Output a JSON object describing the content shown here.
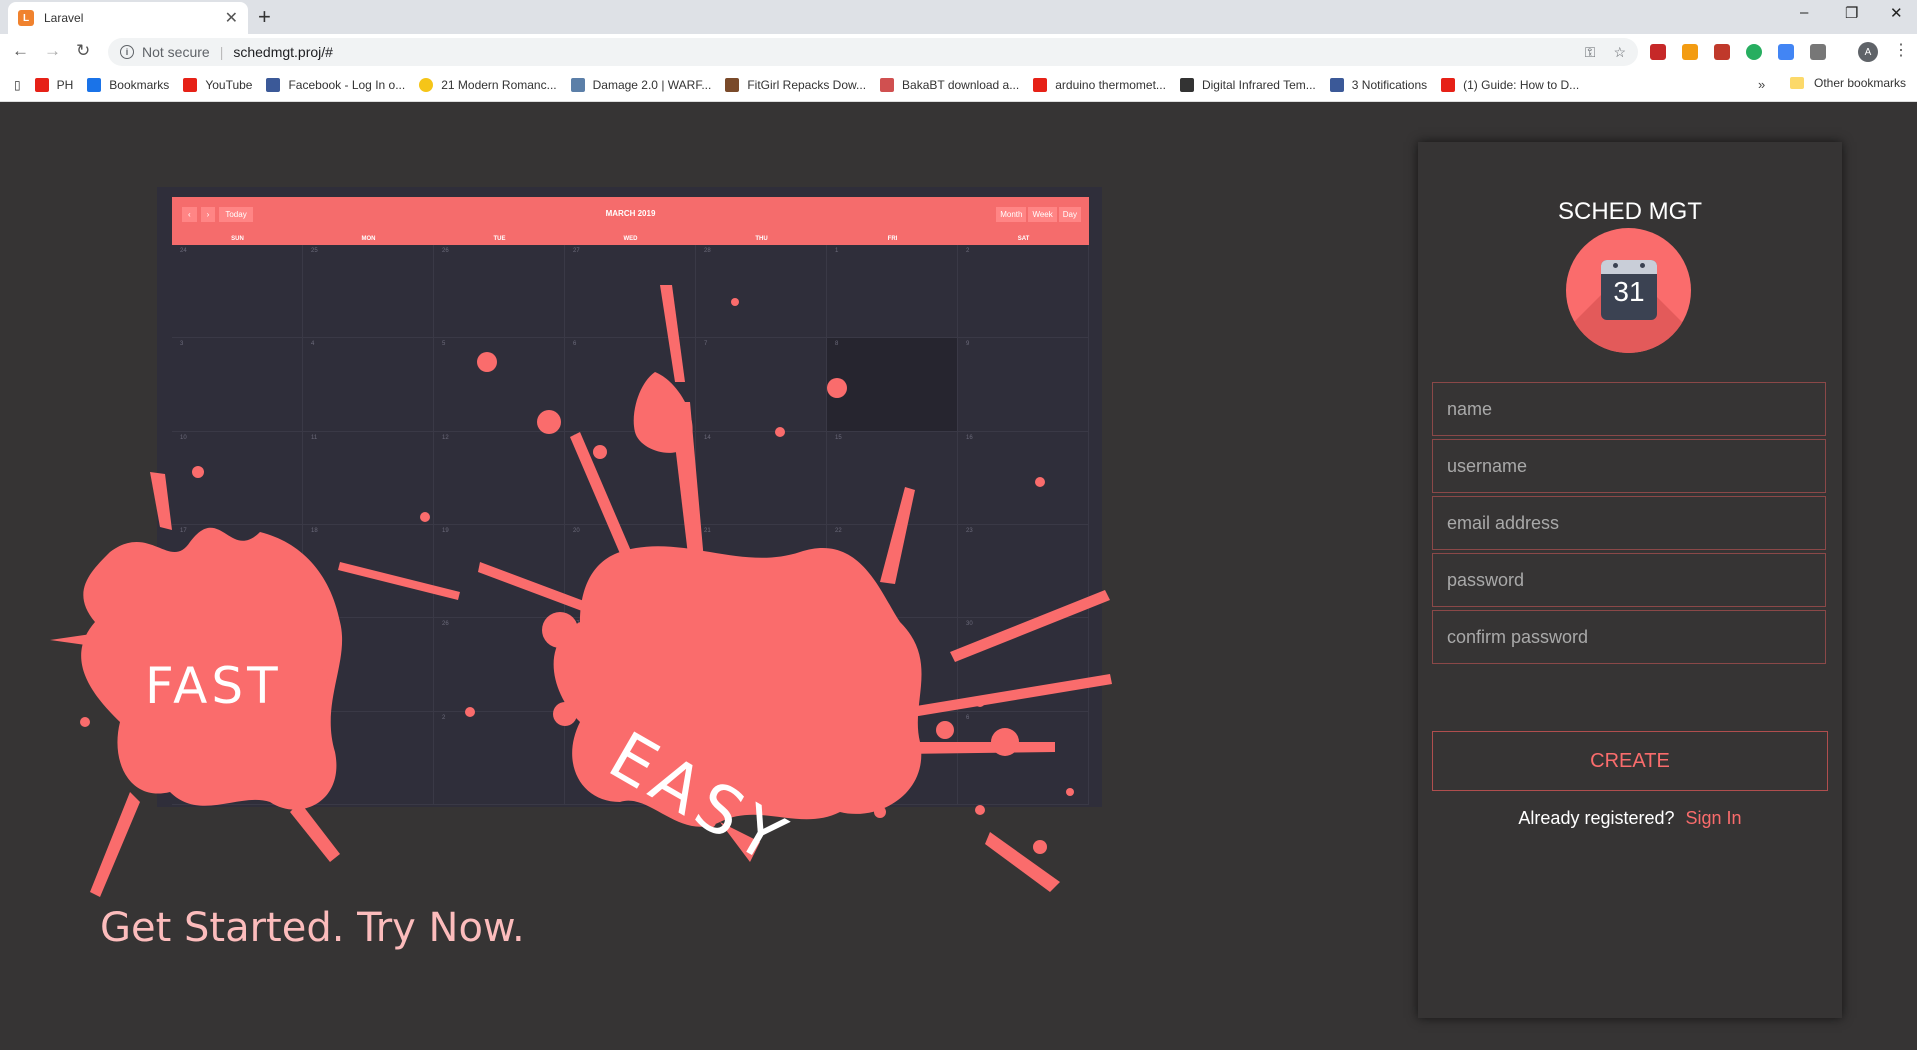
{
  "browser": {
    "tab_title": "Laravel",
    "tab_favicon": "laravel-icon",
    "new_tab_symbol": "+",
    "security_text": "Not secure",
    "url": "schedmgt.proj/#",
    "window_controls": {
      "minimize": "–",
      "restore": "❐",
      "close": "✕"
    },
    "avatar_letter": "A",
    "bookmarks": [
      {
        "label": "PH",
        "icon": "youtube-icon",
        "color": "#e62117"
      },
      {
        "label": "Bookmarks",
        "icon": "star-icon",
        "color": "#1a73e8"
      },
      {
        "label": "YouTube",
        "icon": "youtube-icon",
        "color": "#e62117"
      },
      {
        "label": "Facebook - Log In o...",
        "icon": "facebook-icon",
        "color": "#3b5998"
      },
      {
        "label": "21 Modern Romanc...",
        "icon": "badge-icon",
        "color": "#f5c518"
      },
      {
        "label": "Damage 2.0 | WARF...",
        "icon": "site-icon",
        "color": "#5b7fa8"
      },
      {
        "label": "FitGirl Repacks Dow...",
        "icon": "site-icon",
        "color": "#7a4a2a"
      },
      {
        "label": "BakaBT download a...",
        "icon": "site-icon",
        "color": "#d05050"
      },
      {
        "label": "arduino thermomet...",
        "icon": "youtube-icon",
        "color": "#e62117"
      },
      {
        "label": "Digital Infrared Tem...",
        "icon": "site-icon",
        "color": "#333333"
      },
      {
        "label": "3 Notifications",
        "icon": "facebook-icon",
        "color": "#3b5998"
      },
      {
        "label": "(1) Guide: How to D...",
        "icon": "youtube-icon",
        "color": "#e62117"
      }
    ],
    "bookmarks_more": "»",
    "other_bookmarks": "Other bookmarks"
  },
  "calendar": {
    "title": "MARCH 2019",
    "today_label": "Today",
    "views": [
      "Month",
      "Week",
      "Day"
    ],
    "weekdays": [
      "SUN",
      "MON",
      "TUE",
      "WED",
      "THU",
      "FRI",
      "SAT"
    ],
    "days": [
      "24",
      "25",
      "26",
      "27",
      "28",
      "1",
      "2",
      "3",
      "4",
      "5",
      "6",
      "7",
      "8",
      "9",
      "10",
      "11",
      "12",
      "13",
      "14",
      "15",
      "16",
      "17",
      "18",
      "19",
      "20",
      "21",
      "22",
      "23",
      "24",
      "25",
      "26",
      "27",
      "28",
      "29",
      "30",
      "31",
      "1",
      "2",
      "3",
      "4",
      "5",
      "6"
    ]
  },
  "hero": {
    "word_1": "FAST",
    "word_2": "EASY",
    "tagline": "Get Started. Try Now."
  },
  "signup": {
    "brand": "SCHED MGT",
    "logo_number": "31",
    "fields": {
      "name": "name",
      "username": "username",
      "email": "email address",
      "password": "password",
      "confirm": "confirm password"
    },
    "create_label": "CREATE",
    "already_text": "Already registered?",
    "signin_label": "Sign In"
  },
  "colors": {
    "accent": "#fa6c6c",
    "background": "#363434",
    "calendar_bg": "#2f2e3a"
  }
}
